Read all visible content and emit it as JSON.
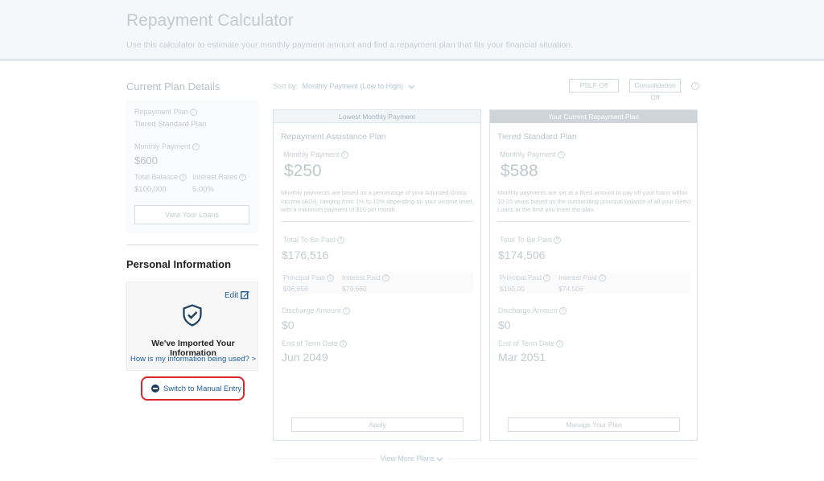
{
  "header": {
    "title": "Repayment Calculator",
    "subtitle": "Use this calculator to estimate your monthly payment amount and find a repayment plan that fits your financial situation."
  },
  "current_plan": {
    "title": "Current Plan Details",
    "repayment_plan_label": "Repayment Plan",
    "repayment_plan_value": "Tiered Standard Plan",
    "monthly_payment_label": "Monthly Payment",
    "monthly_payment_value": "$600",
    "total_balance_label": "Total Balance",
    "total_balance_value": "$100,000",
    "interest_rates_label": "Interest Rates",
    "interest_rates_value": "5.00%",
    "view_loans_label": "View Your Loans"
  },
  "personal_info": {
    "title": "Personal Information",
    "edit_label": "Edit",
    "imported_title": "We've Imported Your Information",
    "how_used_link": "How is my information being used? >",
    "manual_entry_label": "Switch to Manual Entry"
  },
  "toolbar": {
    "sort_by_label": "Sort by:",
    "sort_by_value": "Monthly Payment (Low to High)",
    "pslf_label": "PSLF Off",
    "consolidation_label": "Consolidation Off"
  },
  "plans": [
    {
      "banner": "Lowest Monthly Payment",
      "name": "Repayment Assistance Plan",
      "monthly_payment_label": "Monthly Payment",
      "monthly_payment": "$250",
      "description": "Monthly payments are based on a percentage of your Adjusted Gross Income (AGI), ranging from 1% to 10% depending on your income level, with a minimum payment of $10 per month.",
      "total_label": "Total To Be Paid",
      "total": "$176,516",
      "principal_label": "Principal Paid",
      "principal": "$96,856",
      "interest_label": "Interest Paid",
      "interest": "$79,660",
      "discharge_label": "Discharge Amount",
      "discharge": "$0",
      "end_label": "End of Term Date",
      "end": "Jun 2049",
      "button": "Apply"
    },
    {
      "banner": "Your Current Repayment Plan",
      "name": "Tiered Standard Plan",
      "monthly_payment_label": "Monthly Payment",
      "monthly_payment": "$588",
      "description": "Monthly payments are set at a fixed amount to pay off your loans within 10-25 years based on the outstanding principal balance of all your Direct Loans at the time you enter the plan.",
      "total_label": "Total To Be Paid",
      "total": "$174,506",
      "principal_label": "Principal Paid",
      "principal": "$100,00",
      "interest_label": "Interest Paid",
      "interest": "$74,506",
      "discharge_label": "Discharge Amount",
      "discharge": "$0",
      "end_label": "End of Term Date",
      "end": "Mar 2051",
      "button": "Manage Your Plan"
    }
  ],
  "view_more_label": "View More Plans",
  "icons": {
    "help": "question-circle-icon",
    "edit": "edit-pencil-icon",
    "shield": "shield-check-icon",
    "manual": "minus-circle-icon",
    "chevron": "chevron-down-icon"
  },
  "colors": {
    "accent_blue": "#1f5e9a",
    "highlight_red": "#d9262c",
    "navy": "#1c3e62"
  }
}
